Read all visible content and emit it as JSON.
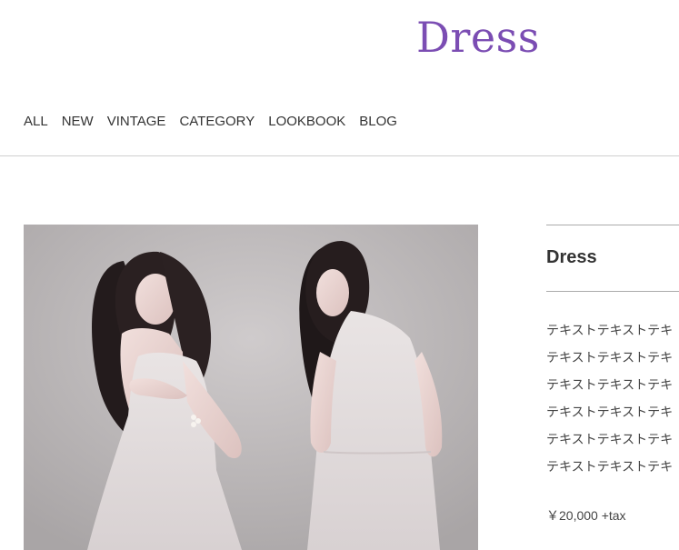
{
  "header": {
    "logo_text": "Dress",
    "logo_color": "#7b4db3"
  },
  "nav": {
    "items": [
      {
        "label": "ALL"
      },
      {
        "label": "NEW"
      },
      {
        "label": "VINTAGE"
      },
      {
        "label": "CATEGORY"
      },
      {
        "label": "LOOKBOOK"
      },
      {
        "label": "BLOG"
      }
    ]
  },
  "product": {
    "image_alt": "Two women in pale sleeveless dresses",
    "title": "Dress",
    "description_lines": [
      "テキストテキストテキ",
      "テキストテキストテキ",
      "テキストテキストテキ",
      "テキストテキストテキ",
      "テキストテキストテキ",
      "テキストテキストテキ"
    ],
    "price": "￥20,000 +tax"
  }
}
